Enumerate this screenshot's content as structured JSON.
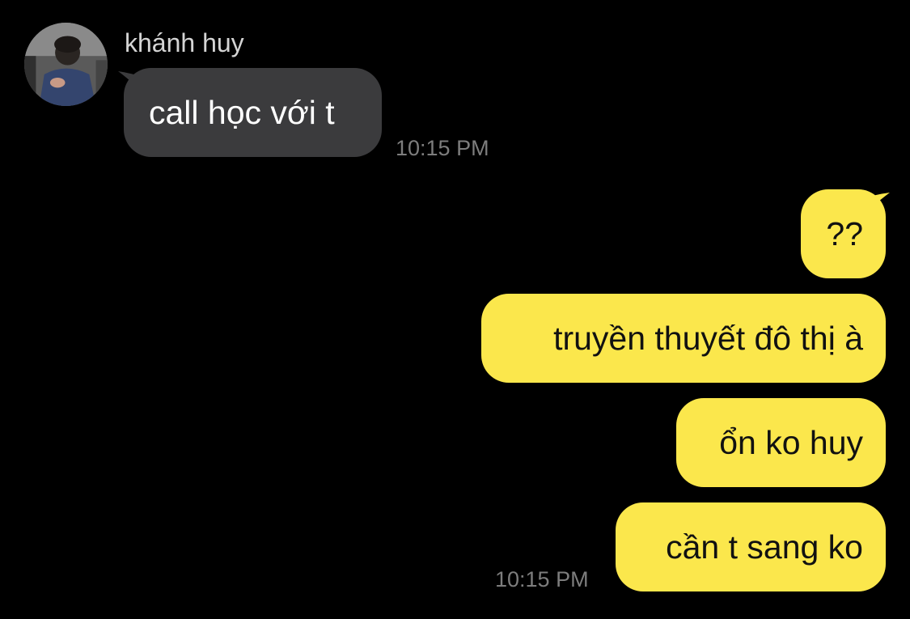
{
  "conversation": {
    "contact": {
      "name": "khánh huy",
      "avatar_icon": "profile-photo"
    },
    "incoming": {
      "messages": [
        "call học với t"
      ],
      "timestamp": "10:15 PM"
    },
    "outgoing": {
      "messages": [
        "??",
        "truyền thuyết đô thị à",
        "ổn ko huy",
        "cần t sang ko"
      ],
      "timestamp": "10:15 PM"
    }
  },
  "colors": {
    "background": "#000000",
    "incoming_bubble": "#3b3b3d",
    "outgoing_bubble": "#fbe74c",
    "timestamp": "#7d7d7d"
  }
}
